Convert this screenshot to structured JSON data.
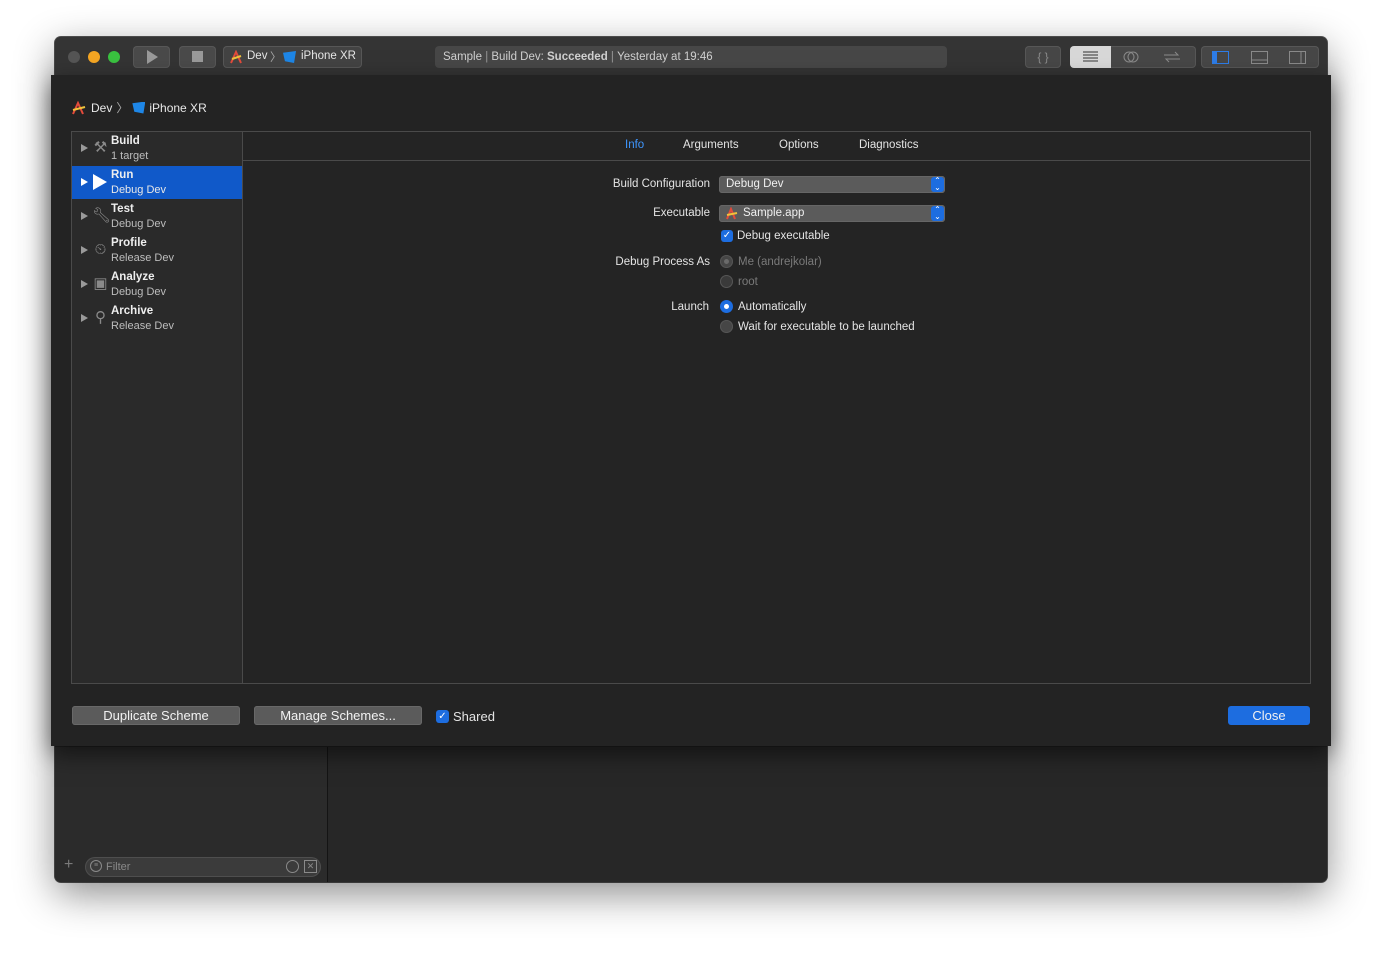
{
  "toolbar": {
    "scheme": "Dev",
    "device": "iPhone XR",
    "activity_project": "Sample",
    "activity_action": "Build Dev: ",
    "activity_status": "Succeeded",
    "activity_time": "Yesterday at 19:46"
  },
  "sheet": {
    "breadcrumb_scheme": "Dev",
    "breadcrumb_device": "iPhone XR",
    "actions": [
      {
        "title": "Build",
        "subtitle": "1 target",
        "icon": "hammer-icon"
      },
      {
        "title": "Run",
        "subtitle": "Debug Dev",
        "icon": "play-icon"
      },
      {
        "title": "Test",
        "subtitle": "Debug Dev",
        "icon": "wrench-icon"
      },
      {
        "title": "Profile",
        "subtitle": "Release Dev",
        "icon": "gauge-icon"
      },
      {
        "title": "Analyze",
        "subtitle": "Debug Dev",
        "icon": "analyze-icon"
      },
      {
        "title": "Archive",
        "subtitle": "Release Dev",
        "icon": "archive-icon"
      }
    ],
    "selected_action": "Run",
    "tabs": [
      "Info",
      "Arguments",
      "Options",
      "Diagnostics"
    ],
    "active_tab": "Info",
    "info": {
      "build_configuration_label": "Build Configuration",
      "build_configuration_value": "Debug Dev",
      "executable_label": "Executable",
      "executable_value": "Sample.app",
      "debug_executable_label": "Debug executable",
      "debug_executable_checked": true,
      "debug_process_as_label": "Debug Process As",
      "debug_process_as_options": [
        "Me (andrejkolar)",
        "root"
      ],
      "launch_label": "Launch",
      "launch_options": [
        "Automatically",
        "Wait for executable to be launched"
      ],
      "launch_selected": "Automatically"
    },
    "footer": {
      "duplicate_label": "Duplicate Scheme",
      "manage_label": "Manage Schemes...",
      "shared_label": "Shared",
      "shared_checked": true,
      "close_label": "Close"
    }
  },
  "navigator": {
    "filter_placeholder": "Filter"
  },
  "colors": {
    "accent": "#1d6de0",
    "selection": "#1059c9",
    "tab_active": "#3e96ff"
  }
}
